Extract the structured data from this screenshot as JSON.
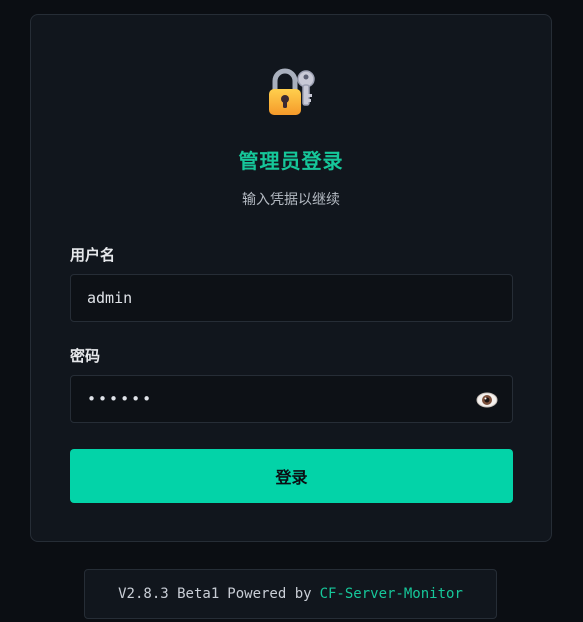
{
  "login": {
    "icon": "lock-with-key-icon",
    "title": "管理员登录",
    "subtitle": "输入凭据以继续",
    "username_label": "用户名",
    "username_value": "admin",
    "password_label": "密码",
    "password_masked": "••••••",
    "password_toggle_icon": "eye-icon",
    "submit_label": "登录"
  },
  "footer": {
    "version": "V2.8.3 Beta1",
    "powered_by": "Powered by",
    "project": "CF-Server-Monitor"
  },
  "colors": {
    "background": "#0b0e13",
    "card": "#11161d",
    "accent": "#16c79a",
    "button": "#03d3a8"
  }
}
